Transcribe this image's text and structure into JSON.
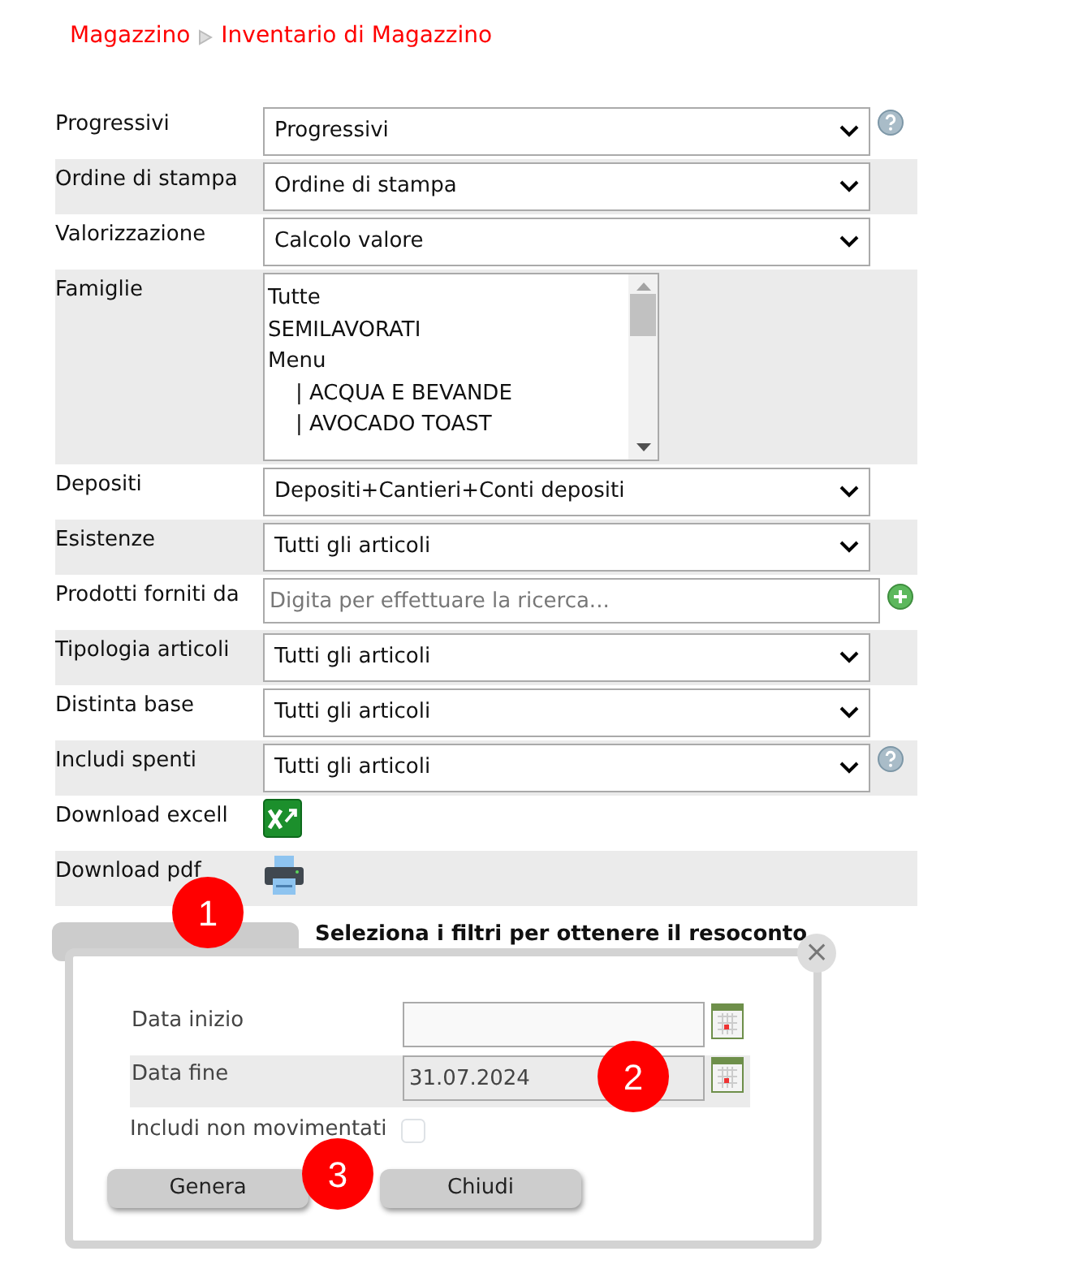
{
  "breadcrumb": [
    "Magazzino",
    "Inventario di Magazzino"
  ],
  "form_rows": [
    {
      "label": "Progressivi",
      "kind": "select",
      "value": "Progressivi",
      "help": true
    },
    {
      "label": "Ordine di stampa",
      "kind": "select",
      "value": "Ordine di stampa"
    },
    {
      "label": "Valorizzazione",
      "kind": "select",
      "value": "Calcolo valore"
    },
    {
      "label": "Famiglie",
      "kind": "listbox",
      "options": [
        {
          "text": "Tutte"
        },
        {
          "text": "SEMILAVORATI"
        },
        {
          "text": "Menu",
          "children": [
            {
              "text": "| ACQUA E BEVANDE"
            },
            {
              "text": "| AVOCADO TOAST"
            }
          ]
        }
      ]
    },
    {
      "label": "Depositi",
      "kind": "select",
      "value": "Depositi+Cantieri+Conti depositi"
    },
    {
      "label": "Esistenze",
      "kind": "select",
      "value": "Tutti gli articoli"
    },
    {
      "label": "Prodotti forniti da",
      "kind": "search",
      "placeholder": "Digita per effettuare la ricerca..."
    },
    {
      "label": "Tipologia articoli",
      "kind": "select",
      "value": "Tutti gli articoli"
    },
    {
      "label": "Distinta base",
      "kind": "select",
      "value": "Tutti gli articoli"
    },
    {
      "label": "Includi spenti",
      "kind": "select",
      "value": "Tutti gli articoli",
      "help": true
    },
    {
      "label": "Download excell",
      "kind": "excel"
    },
    {
      "label": "Download pdf",
      "kind": "pdf"
    }
  ],
  "hint": "Seleziona i filtri per ottenere il resoconto",
  "dialog": {
    "close": "×",
    "fields": [
      {
        "label": "Data inizio",
        "disabled": false
      },
      {
        "label": "Data fine",
        "value": "31.07.2024",
        "disabled": true
      }
    ],
    "checkbox": {
      "label": "Includi non movimentati",
      "checked": false
    },
    "buttons": [
      "Genera",
      "Chiudi"
    ]
  },
  "markers": [
    "1",
    "2",
    "3"
  ]
}
